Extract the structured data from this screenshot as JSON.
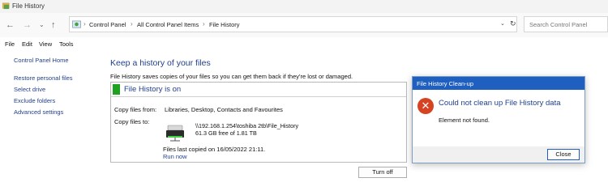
{
  "window": {
    "title": "File History"
  },
  "address": {
    "crumbs": [
      "Control Panel",
      "All Control Panel Items",
      "File History"
    ],
    "search_placeholder": "Search Control Panel"
  },
  "menu": [
    "File",
    "Edit",
    "View",
    "Tools"
  ],
  "sidebar": {
    "home": "Control Panel Home",
    "links": [
      "Restore personal files",
      "Select drive",
      "Exclude folders",
      "Advanced settings"
    ]
  },
  "main": {
    "heading": "Keep a history of your files",
    "description": "File History saves copies of your files so you can get them back if they're lost or damaged.",
    "status": "File History is on",
    "copy_from_label": "Copy files from:",
    "copy_from_value": "Libraries, Desktop, Contacts and Favourites",
    "copy_to_label": "Copy files to:",
    "drive_path": "\\\\192.168.1.254\\toshiba 2tb\\File_History",
    "drive_space": "61.3 GB free of 1.81 TB",
    "last_copied": "Files last copied on 16/05/2022 21:11.",
    "run_now": "Run now",
    "turn_off": "Turn off"
  },
  "dialog": {
    "title": "File History Clean-up",
    "heading": "Could not clean up File History data",
    "message": "Element not found.",
    "close": "Close"
  },
  "colors": {
    "accent": "#1f5fbf",
    "link": "#1f3f8f",
    "status_green": "#1fa21f",
    "error": "#d64322"
  }
}
